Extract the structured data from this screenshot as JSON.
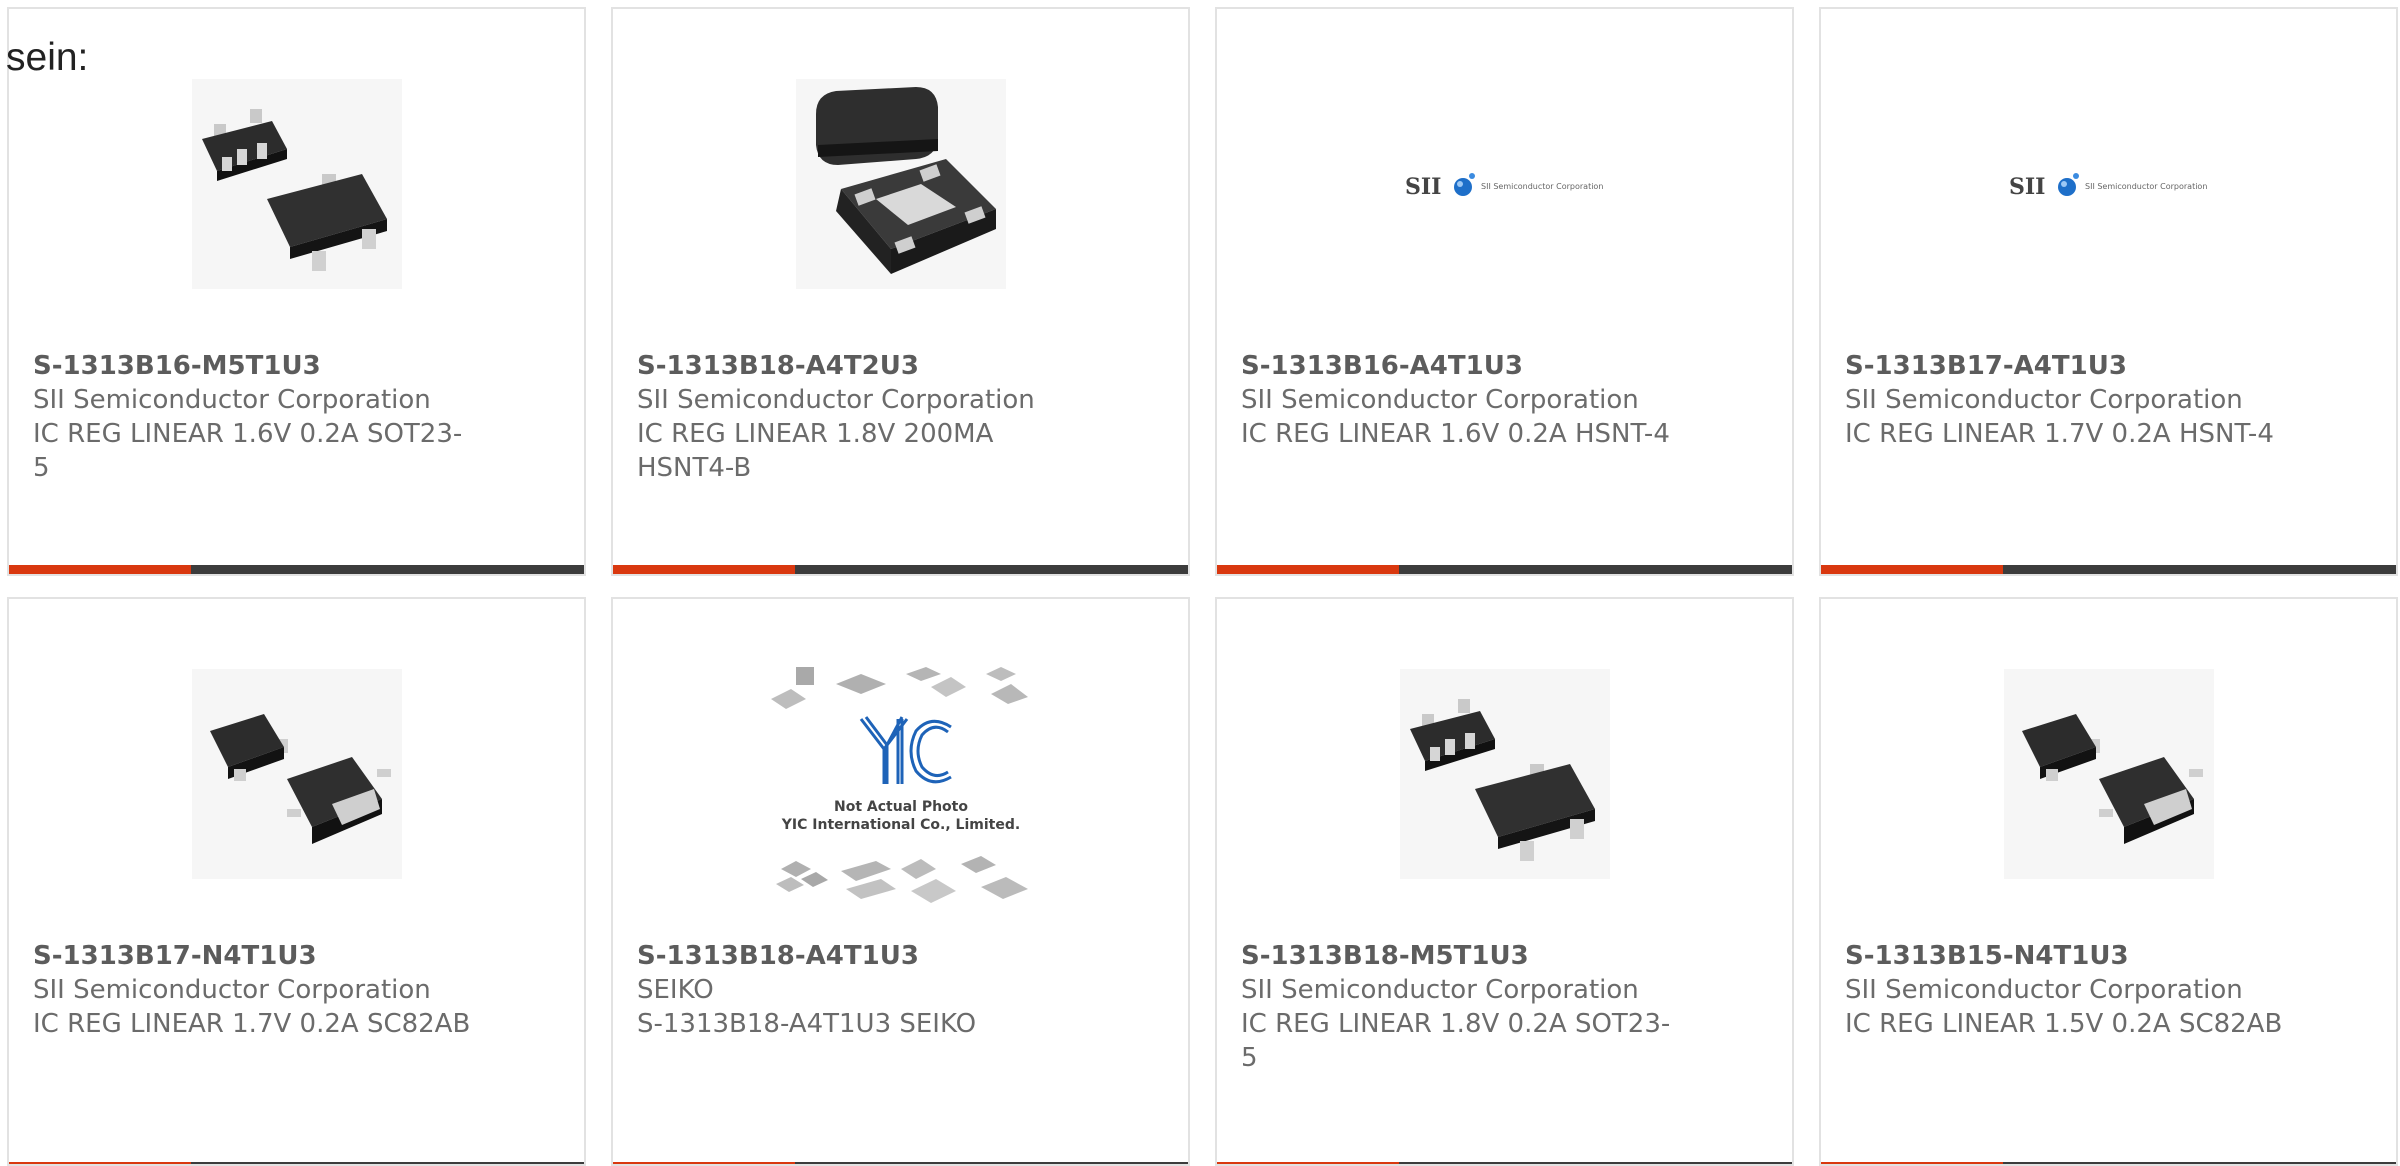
{
  "fragment_text": "sein:",
  "accent_color": "#d9380f",
  "bar_color": "#3c3c3c",
  "products": [
    {
      "part_number": "S-1313B16-M5T1U3",
      "manufacturer": "SII Semiconductor Corporation",
      "description": "IC REG LINEAR 1.6V 0.2A SOT23-5",
      "image": "sot23-5-package-icon"
    },
    {
      "part_number": "S-1313B18-A4T2U3",
      "manufacturer": "SII Semiconductor Corporation",
      "description": "IC REG LINEAR 1.8V 200MA HSNT4-B",
      "image": "hsnt4-package-icon"
    },
    {
      "part_number": "S-1313B16-A4T1U3",
      "manufacturer": "SII Semiconductor Corporation",
      "description": "IC REG LINEAR 1.6V 0.2A HSNT-4",
      "image": "sii-logo-icon",
      "logo_text": "SII",
      "logo_subtext": "SII Semiconductor Corporation"
    },
    {
      "part_number": "S-1313B17-A4T1U3",
      "manufacturer": "SII Semiconductor Corporation",
      "description": "IC REG LINEAR 1.7V 0.2A HSNT-4",
      "image": "sii-logo-icon",
      "logo_text": "SII",
      "logo_subtext": "SII Semiconductor Corporation"
    },
    {
      "part_number": "S-1313B17-N4T1U3",
      "manufacturer": "SII Semiconductor Corporation",
      "description": "IC REG LINEAR 1.7V 0.2A SC82AB",
      "image": "sc82ab-package-icon"
    },
    {
      "part_number": "S-1313B18-A4T1U3",
      "manufacturer": "SEIKO",
      "description": "S-1313B18-A4T1U3 SEIKO",
      "image": "not-actual-photo-placeholder",
      "placeholder_logo": "YIC",
      "placeholder_line1": "Not Actual Photo",
      "placeholder_line2": "YIC International Co., Limited."
    },
    {
      "part_number": "S-1313B18-M5T1U3",
      "manufacturer": "SII Semiconductor Corporation",
      "description": "IC REG LINEAR 1.8V 0.2A SOT23-5",
      "image": "sot23-5-package-icon"
    },
    {
      "part_number": "S-1313B15-N4T1U3",
      "manufacturer": "SII Semiconductor Corporation",
      "description": "IC REG LINEAR 1.5V 0.2A SC82AB",
      "image": "sc82ab-package-icon"
    }
  ]
}
